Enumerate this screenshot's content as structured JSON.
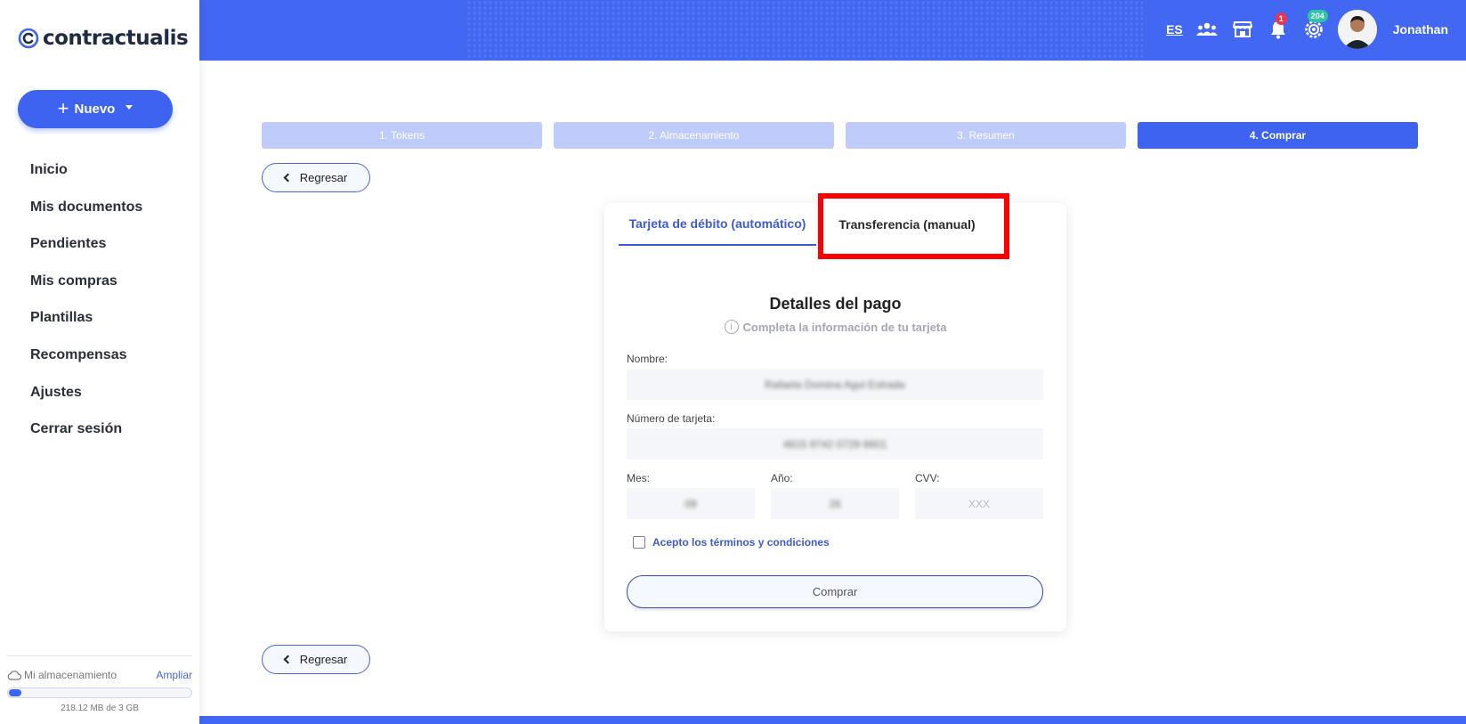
{
  "brand": {
    "name": "contractualis",
    "color": "#3e63f0"
  },
  "sidebar": {
    "new_button": "Nuevo",
    "items": [
      {
        "label": "Inicio"
      },
      {
        "label": "Mis documentos"
      },
      {
        "label": "Pendientes"
      },
      {
        "label": "Mis compras"
      },
      {
        "label": "Plantillas"
      },
      {
        "label": "Recompensas"
      },
      {
        "label": "Ajustes"
      },
      {
        "label": "Cerrar sesión"
      }
    ],
    "storage": {
      "label": "Mi almacenamiento",
      "action": "Ampliar",
      "usage_text": "218.12 MB de 3 GB",
      "used_fraction": 0.071
    }
  },
  "header": {
    "language": "ES",
    "notifications_count": "1",
    "settings_badge": "204",
    "user_name": "Jonathan"
  },
  "steps": [
    {
      "label": "1. Tokens",
      "active": false
    },
    {
      "label": "2. Almacenamiento",
      "active": false
    },
    {
      "label": "3. Resumen",
      "active": false
    },
    {
      "label": "4. Comprar",
      "active": true
    }
  ],
  "back_button": "Regresar",
  "payment": {
    "tabs": [
      {
        "label": "Tarjeta de débito (automático)",
        "active": true
      },
      {
        "label": "Transferencia (manual)",
        "active": false
      }
    ],
    "title": "Detalles del pago",
    "subtitle": "Completa la información de tu tarjeta",
    "name_label": "Nombre:",
    "name_value": "Rafaela Domina Agul Estrada",
    "card_label": "Número de tarjeta:",
    "card_value": "4815 9742 0729 6601",
    "month_label": "Mes:",
    "month_value": "09",
    "year_label": "Año:",
    "year_value": "26",
    "cvv_label": "CVV:",
    "cvv_placeholder": "XXX",
    "terms_label": "Acepto los términos y condiciones",
    "terms_checked": false,
    "buy_button": "Comprar"
  },
  "colors": {
    "primary": "#3e63f0",
    "header_bg": "#4267f2",
    "step_inactive": "#bfcbfa",
    "highlight": "#ff0000",
    "badge_red": "#e8364e",
    "badge_green": "#2cc6a3"
  }
}
